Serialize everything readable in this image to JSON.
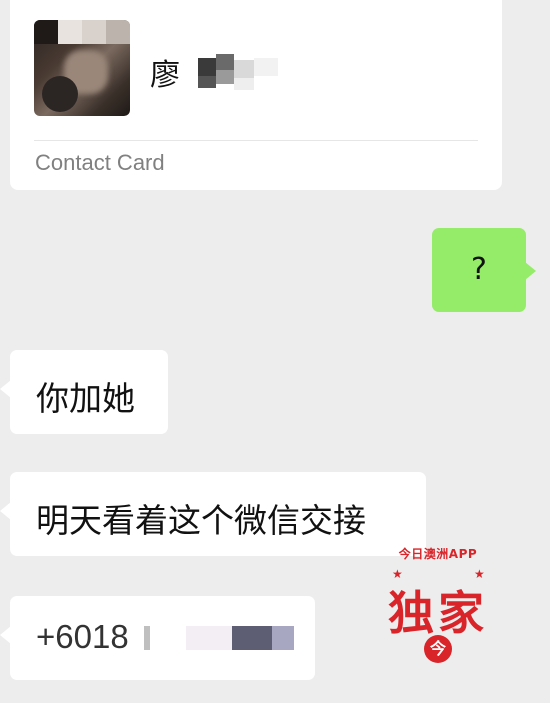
{
  "contact_card": {
    "name_visible": "廖",
    "label": "Contact Card"
  },
  "messages": {
    "outgoing_1": "?",
    "incoming_1": "你加她",
    "incoming_2": "明天看着这个微信交接",
    "incoming_3_prefix": "+6018"
  },
  "watermark": {
    "arc_text": "今日澳洲APP",
    "main_text": "独家",
    "badge": "今",
    "color": "#d9252a"
  },
  "colors": {
    "background": "#ededed",
    "bubble_incoming": "#ffffff",
    "bubble_outgoing": "#95ec69"
  }
}
